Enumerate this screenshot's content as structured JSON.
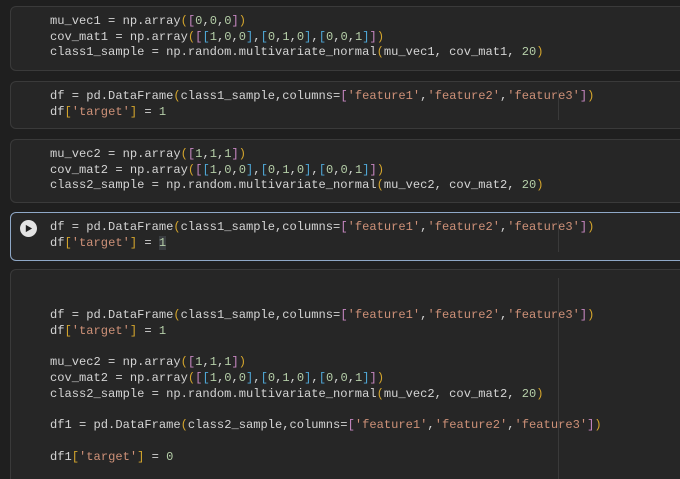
{
  "cells": [
    {
      "id": "cell-1",
      "lines": [
        [
          [
            "v",
            "mu_vec1 = np.array"
          ],
          [
            "pa",
            "("
          ],
          [
            "pb",
            "["
          ],
          [
            "n",
            "0"
          ],
          [
            "v",
            ","
          ],
          [
            "n",
            "0"
          ],
          [
            "v",
            ","
          ],
          [
            "n",
            "0"
          ],
          [
            "pb",
            "]"
          ],
          [
            "pa",
            ")"
          ]
        ],
        [
          [
            "v",
            "cov_mat1 = np.array"
          ],
          [
            "pa",
            "("
          ],
          [
            "pb",
            "["
          ],
          [
            "pc",
            "["
          ],
          [
            "n",
            "1"
          ],
          [
            "v",
            ","
          ],
          [
            "n",
            "0"
          ],
          [
            "v",
            ","
          ],
          [
            "n",
            "0"
          ],
          [
            "pc",
            "]"
          ],
          [
            "v",
            ","
          ],
          [
            "pc",
            "["
          ],
          [
            "n",
            "0"
          ],
          [
            "v",
            ","
          ],
          [
            "n",
            "1"
          ],
          [
            "v",
            ","
          ],
          [
            "n",
            "0"
          ],
          [
            "pc",
            "]"
          ],
          [
            "v",
            ","
          ],
          [
            "pc",
            "["
          ],
          [
            "n",
            "0"
          ],
          [
            "v",
            ","
          ],
          [
            "n",
            "0"
          ],
          [
            "v",
            ","
          ],
          [
            "n",
            "1"
          ],
          [
            "pc",
            "]"
          ],
          [
            "pb",
            "]"
          ],
          [
            "pa",
            ")"
          ]
        ],
        [
          [
            "v",
            "class1_sample = np.random.multivariate_normal"
          ],
          [
            "pa",
            "("
          ],
          [
            "v",
            "mu_vec1, cov_mat1, "
          ],
          [
            "n",
            "20"
          ],
          [
            "pa",
            ")"
          ]
        ]
      ]
    },
    {
      "id": "cell-2",
      "lines": [
        [
          [
            "v",
            "df = pd.DataFrame"
          ],
          [
            "pa",
            "("
          ],
          [
            "v",
            "class1_sample,columns="
          ],
          [
            "pb",
            "["
          ],
          [
            "s",
            "'feature1'"
          ],
          [
            "v",
            ","
          ],
          [
            "s",
            "'feature2'"
          ],
          [
            "v",
            ","
          ],
          [
            "s",
            "'feature3'"
          ],
          [
            "pb",
            "]"
          ],
          [
            "pa",
            ")"
          ]
        ],
        [
          [
            "v",
            "df"
          ],
          [
            "pa",
            "["
          ],
          [
            "s",
            "'target'"
          ],
          [
            "pa",
            "]"
          ],
          [
            "v",
            " = "
          ],
          [
            "n",
            "1"
          ]
        ]
      ]
    },
    {
      "id": "cell-3",
      "lines": [
        [
          [
            "v",
            "mu_vec2 = np.array"
          ],
          [
            "pa",
            "("
          ],
          [
            "pb",
            "["
          ],
          [
            "n",
            "1"
          ],
          [
            "v",
            ","
          ],
          [
            "n",
            "1"
          ],
          [
            "v",
            ","
          ],
          [
            "n",
            "1"
          ],
          [
            "pb",
            "]"
          ],
          [
            "pa",
            ")"
          ]
        ],
        [
          [
            "v",
            "cov_mat2 = np.array"
          ],
          [
            "pa",
            "("
          ],
          [
            "pb",
            "["
          ],
          [
            "pc",
            "["
          ],
          [
            "n",
            "1"
          ],
          [
            "v",
            ","
          ],
          [
            "n",
            "0"
          ],
          [
            "v",
            ","
          ],
          [
            "n",
            "0"
          ],
          [
            "pc",
            "]"
          ],
          [
            "v",
            ","
          ],
          [
            "pc",
            "["
          ],
          [
            "n",
            "0"
          ],
          [
            "v",
            ","
          ],
          [
            "n",
            "1"
          ],
          [
            "v",
            ","
          ],
          [
            "n",
            "0"
          ],
          [
            "pc",
            "]"
          ],
          [
            "v",
            ","
          ],
          [
            "pc",
            "["
          ],
          [
            "n",
            "0"
          ],
          [
            "v",
            ","
          ],
          [
            "n",
            "0"
          ],
          [
            "v",
            ","
          ],
          [
            "n",
            "1"
          ],
          [
            "pc",
            "]"
          ],
          [
            "pb",
            "]"
          ],
          [
            "pa",
            ")"
          ]
        ],
        [
          [
            "v",
            "class2_sample = np.random.multivariate_normal"
          ],
          [
            "pa",
            "("
          ],
          [
            "v",
            "mu_vec2, cov_mat2, "
          ],
          [
            "n",
            "20"
          ],
          [
            "pa",
            ")"
          ]
        ]
      ]
    },
    {
      "id": "cell-4",
      "lines": [
        [
          [
            "v",
            "df = pd.DataFrame"
          ],
          [
            "pa",
            "("
          ],
          [
            "v",
            "class1_sample,columns="
          ],
          [
            "pb",
            "["
          ],
          [
            "s",
            "'feature1'"
          ],
          [
            "v",
            ","
          ],
          [
            "s",
            "'feature2'"
          ],
          [
            "v",
            ","
          ],
          [
            "s",
            "'feature3'"
          ],
          [
            "pb",
            "]"
          ],
          [
            "pa",
            ")"
          ]
        ],
        [
          [
            "v",
            "df"
          ],
          [
            "pa",
            "["
          ],
          [
            "s",
            "'target'"
          ],
          [
            "pa",
            "]"
          ],
          [
            "v",
            " = "
          ],
          [
            "nc",
            "1"
          ]
        ]
      ]
    },
    {
      "id": "cell-5",
      "lines": [
        [],
        [],
        [
          [
            "v",
            "df = pd.DataFrame"
          ],
          [
            "pa",
            "("
          ],
          [
            "v",
            "class1_sample,columns="
          ],
          [
            "pb",
            "["
          ],
          [
            "s",
            "'feature1'"
          ],
          [
            "v",
            ","
          ],
          [
            "s",
            "'feature2'"
          ],
          [
            "v",
            ","
          ],
          [
            "s",
            "'feature3'"
          ],
          [
            "pb",
            "]"
          ],
          [
            "pa",
            ")"
          ]
        ],
        [
          [
            "v",
            "df"
          ],
          [
            "pa",
            "["
          ],
          [
            "s",
            "'target'"
          ],
          [
            "pa",
            "]"
          ],
          [
            "v",
            " = "
          ],
          [
            "n",
            "1"
          ]
        ],
        [],
        [
          [
            "v",
            "mu_vec2 = np.array"
          ],
          [
            "pa",
            "("
          ],
          [
            "pb",
            "["
          ],
          [
            "n",
            "1"
          ],
          [
            "v",
            ","
          ],
          [
            "n",
            "1"
          ],
          [
            "v",
            ","
          ],
          [
            "n",
            "1"
          ],
          [
            "pb",
            "]"
          ],
          [
            "pa",
            ")"
          ]
        ],
        [
          [
            "v",
            "cov_mat2 = np.array"
          ],
          [
            "pa",
            "("
          ],
          [
            "pb",
            "["
          ],
          [
            "pc",
            "["
          ],
          [
            "n",
            "1"
          ],
          [
            "v",
            ","
          ],
          [
            "n",
            "0"
          ],
          [
            "v",
            ","
          ],
          [
            "n",
            "0"
          ],
          [
            "pc",
            "]"
          ],
          [
            "v",
            ","
          ],
          [
            "pc",
            "["
          ],
          [
            "n",
            "0"
          ],
          [
            "v",
            ","
          ],
          [
            "n",
            "1"
          ],
          [
            "v",
            ","
          ],
          [
            "n",
            "0"
          ],
          [
            "pc",
            "]"
          ],
          [
            "v",
            ","
          ],
          [
            "pc",
            "["
          ],
          [
            "n",
            "0"
          ],
          [
            "v",
            ","
          ],
          [
            "n",
            "0"
          ],
          [
            "v",
            ","
          ],
          [
            "n",
            "1"
          ],
          [
            "pc",
            "]"
          ],
          [
            "pb",
            "]"
          ],
          [
            "pa",
            ")"
          ]
        ],
        [
          [
            "v",
            "class2_sample = np.random.multivariate_normal"
          ],
          [
            "pa",
            "("
          ],
          [
            "v",
            "mu_vec2, cov_mat2, "
          ],
          [
            "n",
            "20"
          ],
          [
            "pa",
            ")"
          ]
        ],
        [],
        [
          [
            "v",
            "df1 = pd.DataFrame"
          ],
          [
            "pa",
            "("
          ],
          [
            "v",
            "class2_sample,columns="
          ],
          [
            "pb",
            "["
          ],
          [
            "s",
            "'feature1'"
          ],
          [
            "v",
            ","
          ],
          [
            "s",
            "'feature2'"
          ],
          [
            "v",
            ","
          ],
          [
            "s",
            "'feature3'"
          ],
          [
            "pb",
            "]"
          ],
          [
            "pa",
            ")"
          ]
        ],
        [],
        [
          [
            "v",
            "df1"
          ],
          [
            "pa",
            "["
          ],
          [
            "s",
            "'target'"
          ],
          [
            "pa",
            "]"
          ],
          [
            "v",
            " = "
          ],
          [
            "n",
            "0"
          ]
        ]
      ]
    }
  ],
  "icons": {
    "run": "play-icon"
  },
  "colors": {
    "background": "#1f1f1f",
    "cell_background": "#262626",
    "active_border": "#8fa8c7",
    "string": "#ce9178",
    "number": "#b5cea8",
    "paren": "#d4a52c",
    "bracket": "#c586c0",
    "inner_bracket": "#4fa7d6"
  }
}
